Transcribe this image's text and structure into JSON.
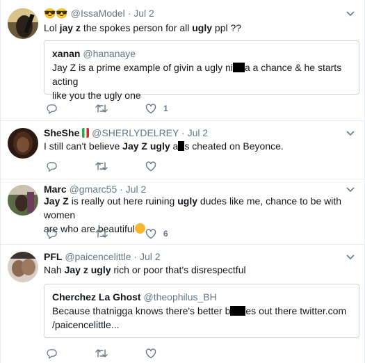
{
  "tweets": [
    {
      "name": "😎😎",
      "handle": "@IssaModel",
      "sep": "·",
      "date": "Jul 2",
      "text_parts": [
        "Lol ",
        "jay z",
        " the spokes person for all ",
        "ugly",
        " ppl ??"
      ],
      "quote": {
        "name": "xanan",
        "handle": "@hananaye",
        "line1_a": "Jay Z is a prime example of givin a ugly ni",
        "line1_b": "a a chance & he starts acting",
        "line2": "like you the ugly one"
      },
      "likes": "1"
    },
    {
      "name": "SheShe",
      "handle": "@SHERLYDELREY",
      "sep": "·",
      "date": "Jul 2",
      "text_a": "I still can't believe ",
      "text_bold1": "Jay Z",
      "text_space": " ",
      "text_bold2": "ugly",
      "text_b": " a",
      "text_c": "s cheated on Beyonce."
    },
    {
      "name": "Marc",
      "handle": "@gmarc55",
      "sep": "·",
      "date": "Jul 2",
      "line1_bold1": "Jay Z",
      "line1_a": " is really out here ruining ",
      "line1_bold2": "ugly",
      "line1_b": " dudes like me, chance to be with women",
      "line2": "are who are beautiful",
      "likes": "6"
    },
    {
      "name": "PFL",
      "handle": "@paicencelittle",
      "sep": "·",
      "date": "Jul 2",
      "text_a": "Nah ",
      "text_bold1": "Jay z",
      "text_space": " ",
      "text_bold2": "ugly",
      "text_b": " rich or poor that's disrespectful",
      "quote": {
        "name": "Cherchez La Ghost",
        "handle": "@theophilus_BH",
        "line1_a": "Because thatnigga knows there's better b",
        "line1_b": "es out there twitter.com",
        "line2": "/paicencelittle..."
      }
    }
  ],
  "icons": {
    "reply": "reply-icon",
    "retweet": "retweet-icon",
    "like": "heart-icon",
    "caret": "chevron-down-icon"
  },
  "colors": {
    "text": "#14171a",
    "secondary": "#657786",
    "border": "#e6ecf0",
    "quote_border": "#ccd6dd"
  }
}
